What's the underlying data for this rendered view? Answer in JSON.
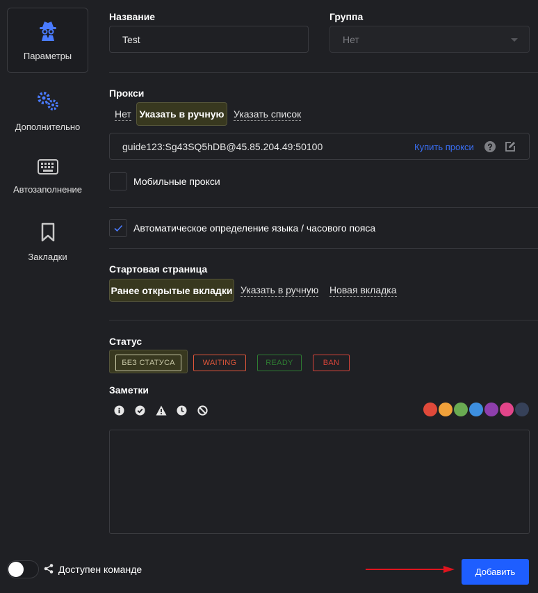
{
  "sidebar": {
    "items": [
      {
        "label": "Параметры",
        "icon": "spy-icon"
      },
      {
        "label": "Дополнительно",
        "icon": "gears-icon"
      },
      {
        "label": "Автозаполнение",
        "icon": "keyboard-icon"
      },
      {
        "label": "Закладки",
        "icon": "bookmark-icon"
      }
    ]
  },
  "name": {
    "label": "Название",
    "value": "Test"
  },
  "group": {
    "label": "Группа",
    "value": "Нет"
  },
  "proxy": {
    "label": "Прокси",
    "options": [
      "Нет",
      "Указать в ручную",
      "Указать список"
    ],
    "selected": "Указать в ручную",
    "value": "guide123:Sg43SQ5hDB@45.85.204.49:50100",
    "buy_link": "Купить прокси",
    "mobile_label": "Мобильные прокси",
    "mobile_checked": false
  },
  "auto_lang": {
    "label": "Автоматическое определение языка / часового пояса",
    "checked": true
  },
  "start_page": {
    "label": "Стартовая страница",
    "options": [
      "Ранее открытые вкладки",
      "Указать в ручную",
      "Новая вкладка"
    ],
    "selected": "Ранее открытые вкладки"
  },
  "status": {
    "label": "Статус",
    "options": [
      "БЕЗ СТАТУСА",
      "WAITING",
      "READY",
      "BAN"
    ],
    "selected": "БЕЗ СТАТУСА"
  },
  "notes": {
    "label": "Заметки",
    "icons": [
      "info-icon",
      "check-icon",
      "warning-icon",
      "clock-icon",
      "forbidden-icon"
    ],
    "colors": [
      "#e0493a",
      "#f0a13a",
      "#6aab52",
      "#3d8fe0",
      "#8e3fad",
      "#e2458a",
      "#364159"
    ]
  },
  "footer": {
    "share_label": "Доступен команде",
    "share_enabled": false,
    "add_label": "Добавить",
    "accent": "#1e5eff",
    "arrow_color": "#e0141e"
  }
}
